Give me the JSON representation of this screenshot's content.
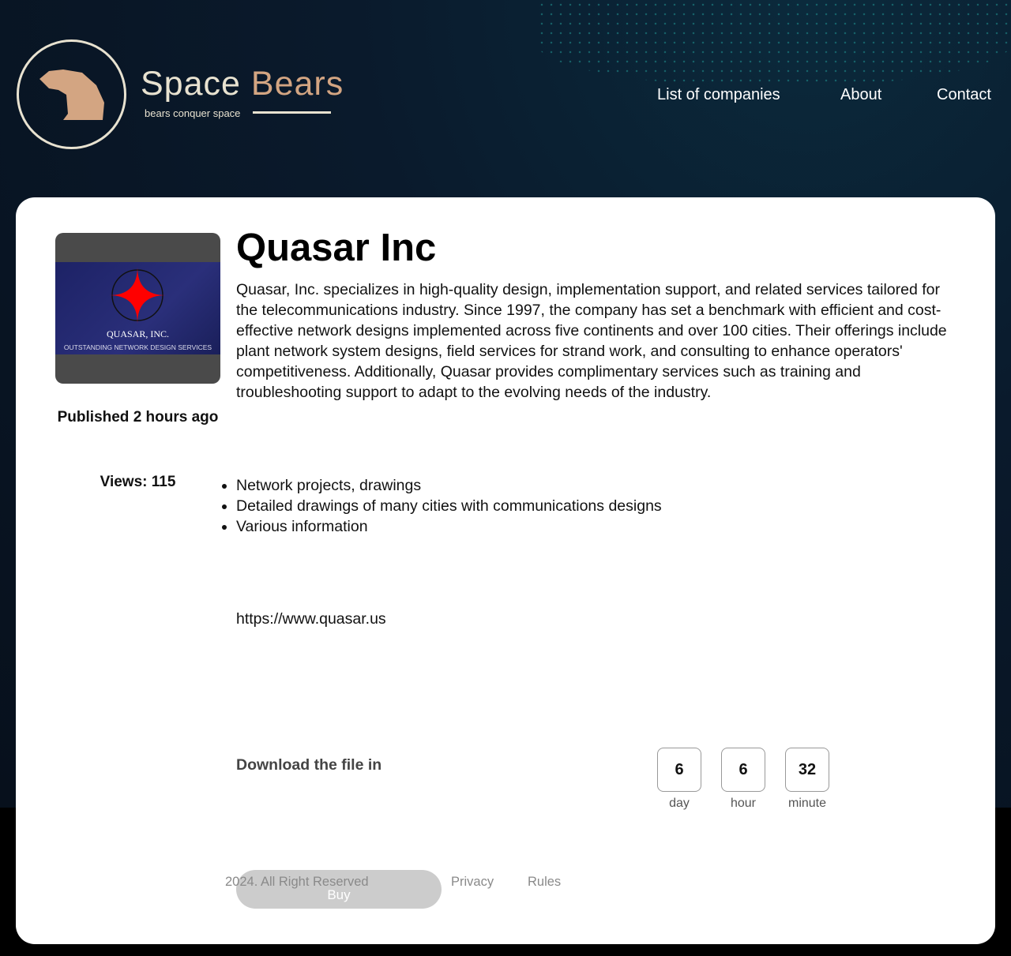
{
  "header": {
    "brand_part1": "Space",
    "brand_part2": "Bears",
    "tagline": "bears conquer space",
    "nav": [
      "List of companies",
      "About",
      "Contact"
    ]
  },
  "company": {
    "name": "Quasar Inc",
    "logo_name": "QUASAR, INC.",
    "logo_tagline": "OUTSTANDING NETWORK DESIGN SERVICES",
    "published": "Published 2 hours ago",
    "views": "Views: 115",
    "description": "Quasar, Inc. specializes in high-quality design, implementation support, and related services tailored for the telecommunications industry. Since 1997, the company has set a benchmark with efficient and cost-effective network designs implemented across five continents and over 100 cities. Their offerings include plant network system designs, field services for strand work, and consulting to enhance operators' competitiveness. Additionally, Quasar provides complimentary services such as training and troubleshooting support to adapt to the evolving needs of the industry.",
    "items": [
      "Network projects, drawings",
      "Detailed drawings of many cities with communications designs",
      "Various information"
    ],
    "url": "https://www.quasar.us"
  },
  "download": {
    "label": "Download the file in",
    "countdown": [
      {
        "value": "6",
        "unit": "day"
      },
      {
        "value": "6",
        "unit": "hour"
      },
      {
        "value": "32",
        "unit": "minute"
      }
    ],
    "buy_label": "Buy"
  },
  "footer": {
    "copyright": "2024. All Right Reserved",
    "privacy": "Privacy",
    "rules": "Rules"
  }
}
